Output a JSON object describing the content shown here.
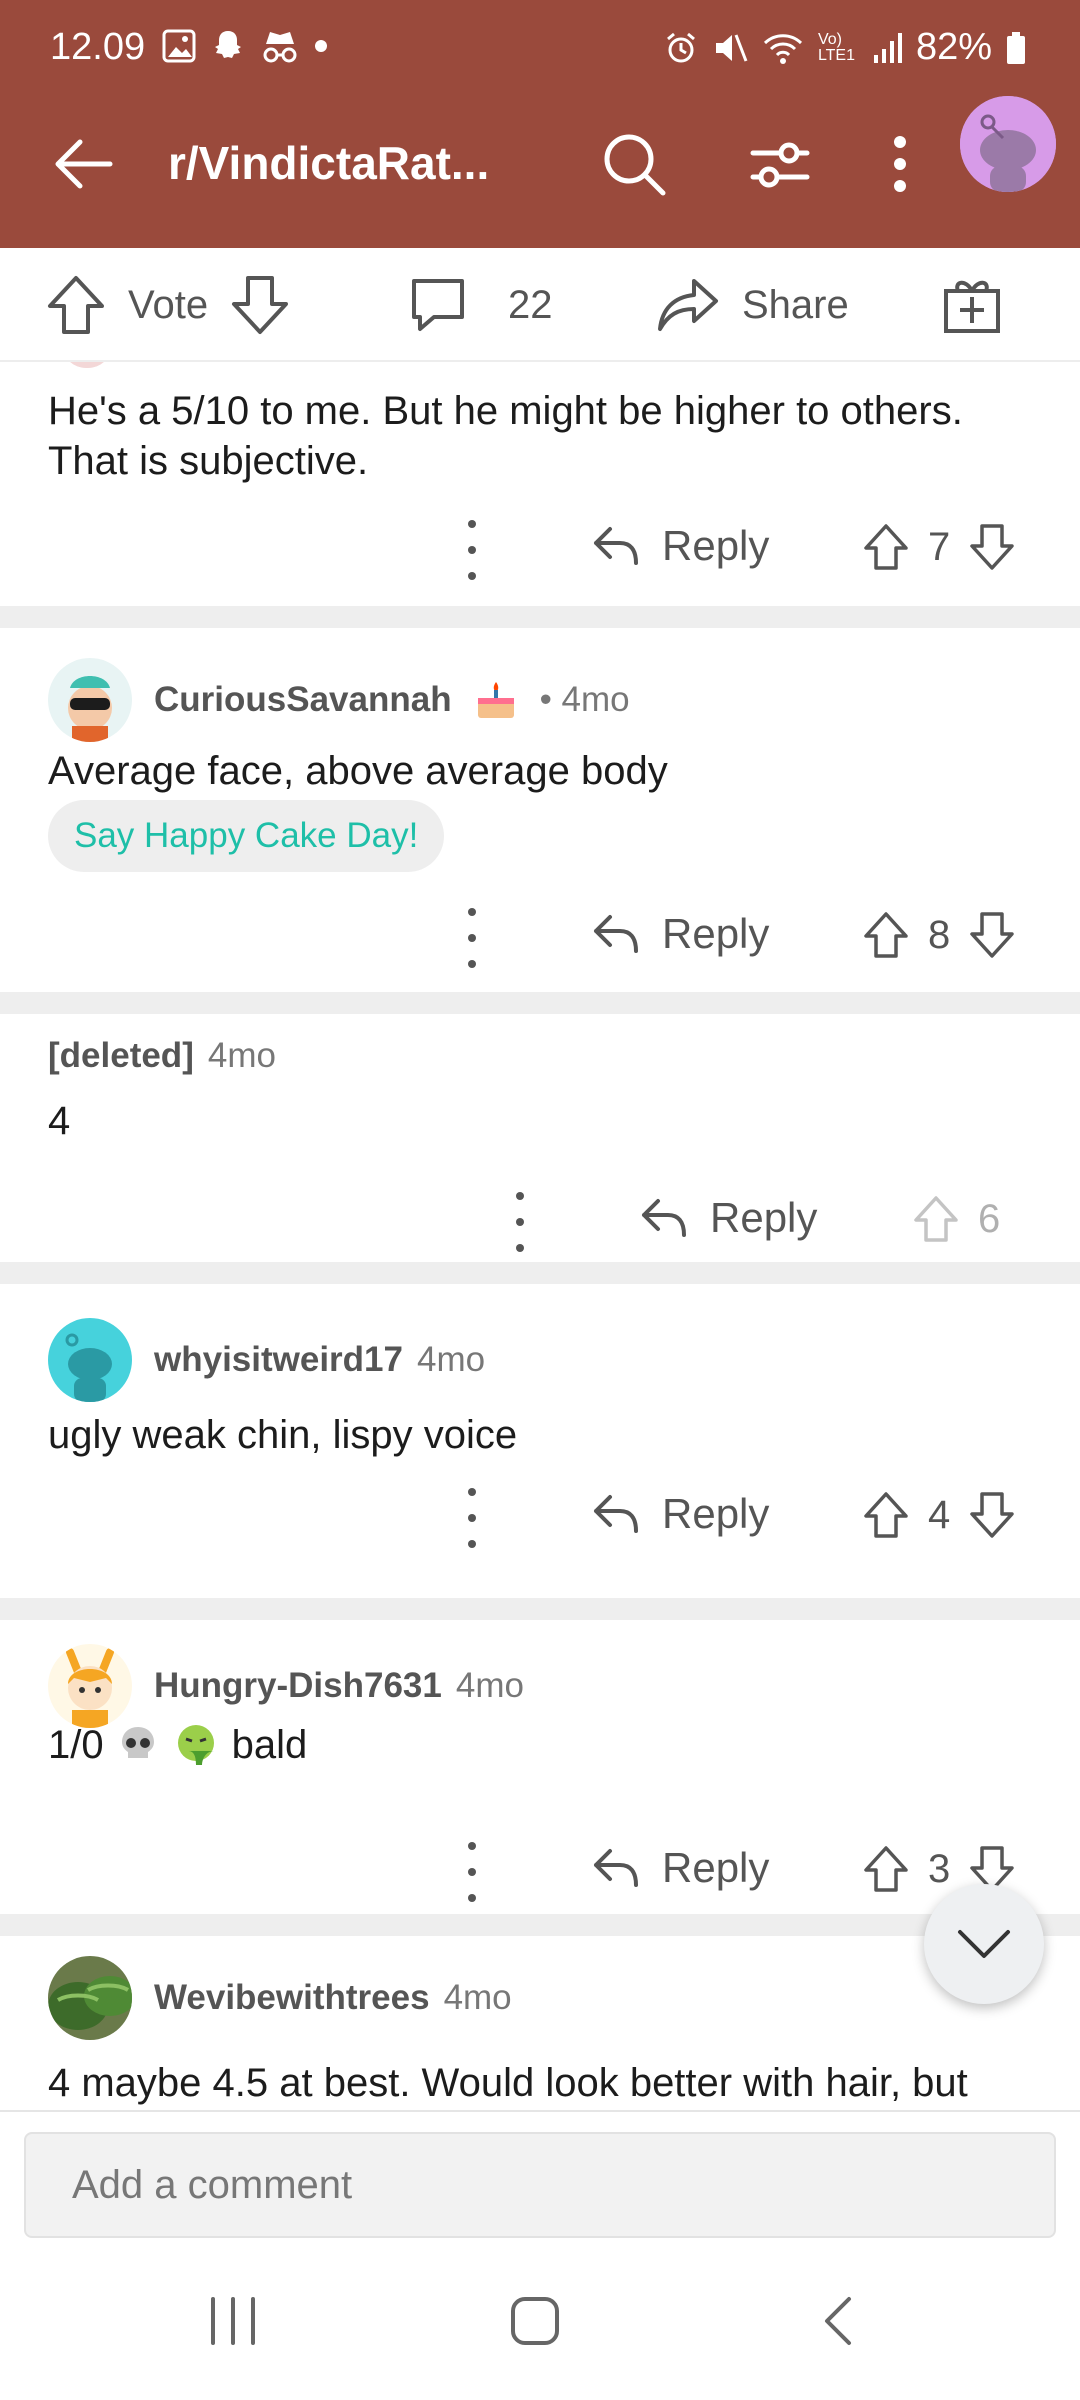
{
  "status": {
    "time": "12.09",
    "battery": "82%",
    "network": "Vo) LTE1"
  },
  "header": {
    "title": "r/VindictaRat..."
  },
  "actionbar": {
    "vote_label": "Vote",
    "comment_count": "22",
    "share_label": "Share"
  },
  "comments": [
    {
      "body": "He's a 5/10 to me. But he might be higher to others. That is subjective.",
      "reply_label": "Reply",
      "score": "7"
    },
    {
      "user": "CuriousSavannah",
      "time": "• 4mo",
      "body": "Average face, above average body",
      "cake_label": "Say Happy Cake Day!",
      "reply_label": "Reply",
      "score": "8"
    },
    {
      "user": "[deleted]",
      "time": "4mo",
      "body": "4",
      "reply_label": "Reply",
      "score": "6"
    },
    {
      "user": "whyisitweird17",
      "time": "4mo",
      "body": "ugly weak chin, lispy voice",
      "reply_label": "Reply",
      "score": "4"
    },
    {
      "user": "Hungry-Dish7631",
      "time": "4mo",
      "body_prefix": "1/0",
      "body_suffix": "bald",
      "reply_label": "Reply",
      "score": "3"
    },
    {
      "user": "Wevibewithtrees",
      "time": "4mo",
      "body": "4 maybe 4.5 at best. Would look better with hair, but"
    }
  ],
  "comment_input": {
    "placeholder": "Add a comment"
  },
  "colors": {
    "header": "#9a4a3c",
    "cake_text": "#1ebfa8",
    "avatar_top": "#d79be8"
  }
}
